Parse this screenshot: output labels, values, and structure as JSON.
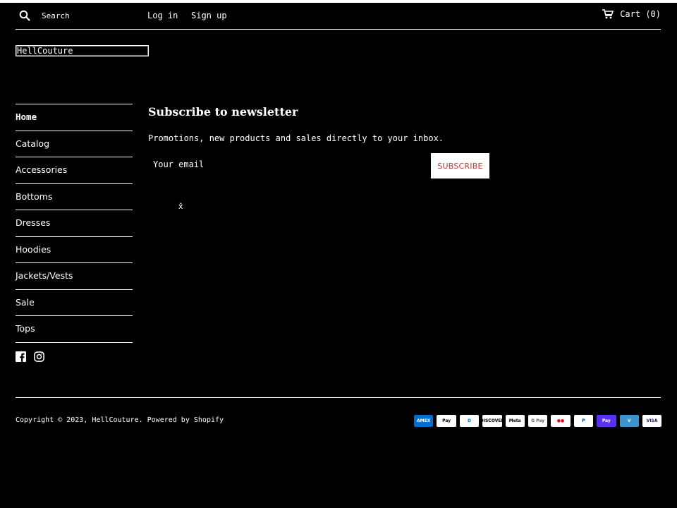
{
  "header": {
    "search_placeholder": "Search",
    "login_label": "Log in",
    "signup_label": "Sign up",
    "cart_label": "Cart (0)"
  },
  "logo": {
    "text": "HellCouture"
  },
  "sidebar": {
    "items": [
      {
        "label": "Home",
        "active": true
      },
      {
        "label": "Catalog"
      },
      {
        "label": "Accessories"
      },
      {
        "label": "Bottoms"
      },
      {
        "label": "Dresses"
      },
      {
        "label": "Hoodies"
      },
      {
        "label": "Jackets/Vests"
      },
      {
        "label": "Sale"
      },
      {
        "label": "Tops"
      }
    ]
  },
  "social": {
    "facebook_icon": "facebook-icon",
    "instagram_icon": "instagram-icon"
  },
  "newsletter": {
    "title": "Subscribe to newsletter",
    "description": "Promotions, new products and sales directly to your inbox.",
    "email_placeholder": "Your email",
    "subscribe_label": "SUBSCRIBE",
    "close_glyph": "x̂"
  },
  "footer": {
    "copyright": "Copyright © 2023, HellCouture. Powered by Shopify",
    "payments": [
      {
        "name": "AMEX",
        "bg": "#016fd0",
        "fg": "#ffffff"
      },
      {
        "name": "Pay",
        "bg": "#ffffff",
        "fg": "#000000"
      },
      {
        "name": "D",
        "bg": "#ffffff",
        "fg": "#0079be"
      },
      {
        "name": "DISCOVER",
        "bg": "#ffffff",
        "fg": "#000000"
      },
      {
        "name": "Meta",
        "bg": "#ffffff",
        "fg": "#000000"
      },
      {
        "name": "G Pay",
        "bg": "#ffffff",
        "fg": "#5f6368"
      },
      {
        "name": "●●",
        "bg": "#ffffff",
        "fg": "#eb001b"
      },
      {
        "name": "P",
        "bg": "#ffffff",
        "fg": "#003087"
      },
      {
        "name": "Pay",
        "bg": "#5a31f4",
        "fg": "#ffffff"
      },
      {
        "name": "V",
        "bg": "#3d95ce",
        "fg": "#ffffff"
      },
      {
        "name": "VISA",
        "bg": "#ffffff",
        "fg": "#1a1f71"
      }
    ]
  },
  "colors": {
    "background": "#000000",
    "text": "#ffffff",
    "accent": "#c0392b"
  }
}
